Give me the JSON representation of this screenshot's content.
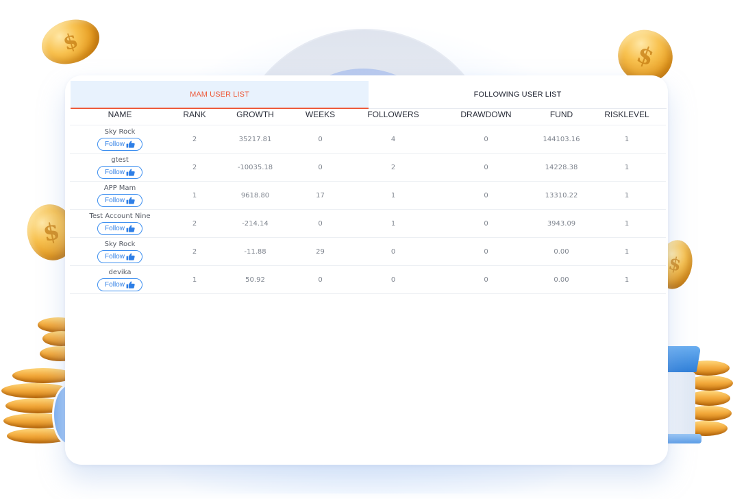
{
  "tabs": [
    {
      "label": "MAM USER LIST",
      "active": true
    },
    {
      "label": "FOLLOWING USER LIST",
      "active": false
    }
  ],
  "columns": [
    "NAME",
    "RANK",
    "GROWTH",
    "WEEKS",
    "FOLLOWERS",
    "DRAWDOWN",
    "FUND",
    "RISKLEVEL"
  ],
  "follow_label": "Follow",
  "rows": [
    {
      "name": "Sky Rock",
      "rank": "2",
      "growth": "35217.81",
      "weeks": "0",
      "followers": "4",
      "drawdown": "0",
      "fund": "144103.16",
      "risklevel": "1"
    },
    {
      "name": "gtest",
      "rank": "2",
      "growth": "-10035.18",
      "weeks": "0",
      "followers": "2",
      "drawdown": "0",
      "fund": "14228.38",
      "risklevel": "1"
    },
    {
      "name": "APP Mam",
      "rank": "1",
      "growth": "9618.80",
      "weeks": "17",
      "followers": "1",
      "drawdown": "0",
      "fund": "13310.22",
      "risklevel": "1"
    },
    {
      "name": "Test Account Nine",
      "rank": "2",
      "growth": "-214.14",
      "weeks": "0",
      "followers": "1",
      "drawdown": "0",
      "fund": "3943.09",
      "risklevel": "1"
    },
    {
      "name": "Sky Rock",
      "rank": "2",
      "growth": "-11.88",
      "weeks": "29",
      "followers": "0",
      "drawdown": "0",
      "fund": "0.00",
      "risklevel": "1"
    },
    {
      "name": "devika",
      "rank": "1",
      "growth": "50.92",
      "weeks": "0",
      "followers": "0",
      "drawdown": "0",
      "fund": "0.00",
      "risklevel": "1"
    }
  ],
  "colors": {
    "accent": "#ee5a3a",
    "follow_blue": "#2f7fe6",
    "tab_active_bg": "#e8f2fd"
  },
  "icons": {
    "follow": "thumbs-up-icon",
    "coin": "dollar-coin-icon"
  }
}
